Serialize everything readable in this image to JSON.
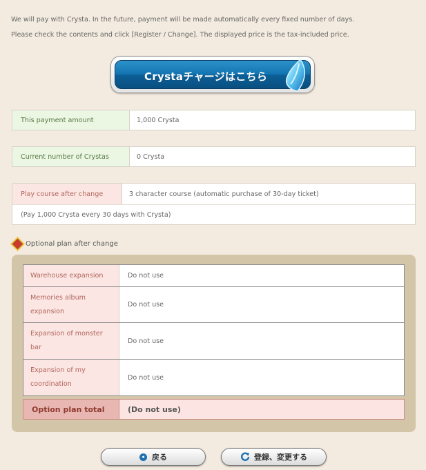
{
  "intro": {
    "line1": "We will pay with Crysta. In the future, payment will be made automatically every fixed number of days.",
    "line2": "Please check the contents and click [Register / Change]. The displayed price is the tax-included price."
  },
  "charge_button": {
    "label": "Crystaチャージはこちら"
  },
  "payment": {
    "label": "This payment amount",
    "value": "1,000 Crysta"
  },
  "current": {
    "label": "Current number of Crystas",
    "value": "0 Crysta"
  },
  "course": {
    "label": "Play course after change",
    "value": "3 character course (automatic purchase of 30-day ticket)",
    "note": "(Pay 1,000 Crysta every 30 days with Crysta)"
  },
  "options": {
    "title": "Optional plan after change",
    "rows": [
      {
        "label": "Warehouse expansion",
        "value": "Do not use"
      },
      {
        "label": "Memories album expansion",
        "value": "Do not use"
      },
      {
        "label": "Expansion of monster bar",
        "value": "Do not use"
      },
      {
        "label": "Expansion of my coordination",
        "value": "Do not use"
      }
    ],
    "total_label": "Option plan total",
    "total_value": "(Do not use)"
  },
  "buttons": {
    "back": "戻る",
    "register": "登録、変更する"
  },
  "colors": {
    "accent_blue": "#1375b1",
    "green_cell": "#ebf6e3",
    "pink_cell": "#fbe6e3",
    "panel": "#d3c5a8"
  }
}
